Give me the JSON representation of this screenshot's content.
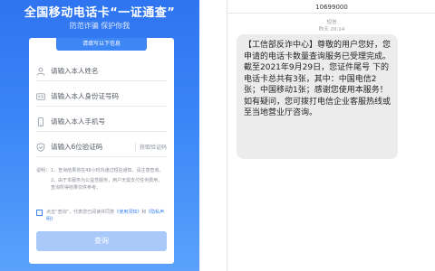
{
  "left": {
    "title": "全国移动电话卡“一证通查”",
    "subtitle": "防范诈骗 保护你我",
    "form_tab": "请填写以下信息",
    "fields": {
      "name_placeholder": "请输入本人姓名",
      "id_placeholder": "请输入本人身份证号码",
      "phone_placeholder": "请输入本人手机号",
      "code_placeholder": "请输入6位验证码",
      "get_code_label": "获取验证码"
    },
    "notes": {
      "label": "说明：",
      "item1": "1、查询结果将在48小时内通过短信通知，请注意查收。",
      "item2": "2、由于本服务为公益性服务，用户无需支付任何费用，查询所得结果仅供参考。"
    },
    "agreement": {
      "prefix": "点击“查询”，代表您已阅读并同意",
      "terms_link": "《使用须知》",
      "and": "和",
      "privacy_link": "《隐私声明》"
    },
    "query_button": "查询"
  },
  "right": {
    "sender_number": "10699000",
    "channel_label": "短信",
    "time": "昨天 20:14",
    "message": "【工信部反诈中心】尊敬的用户您好，您申请的电话卡数量查询服务已受理完成。截至2021年9月29日，您证件尾号      下的电话卡总共有3张，其中：中国电信2张；中国移动1张；感谢您使用本服务！如有疑问，您可拨打电信企业客服热线或至当地营业厅咨询。"
  },
  "icons": {
    "person": "person-icon",
    "id_card": "id-card-icon",
    "phone": "phone-icon",
    "shield": "shield-check-icon"
  },
  "colors": {
    "brand_blue": "#3d86f5",
    "query_button_bg": "#a8c9fa",
    "bubble_bg": "#ececec"
  }
}
